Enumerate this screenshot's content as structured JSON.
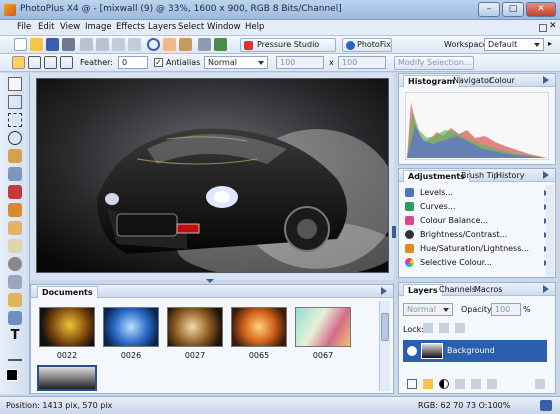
{
  "window": {
    "title": "PhotoPlus X4 @ - [mixwall (9) @ 33%, 1600 x 900, RGB 8 Bits/Channel]"
  },
  "menu": [
    "File",
    "Edit",
    "View",
    "Image",
    "Effects",
    "Layers",
    "Select",
    "Window",
    "Help"
  ],
  "toolbar": {
    "pressure_studio": "Pressure Studio",
    "photofix": "PhotoFix",
    "workspace_label": "Workspace",
    "workspace_value": "Default"
  },
  "context_bar": {
    "feather_label": "Feather:",
    "feather_value": "0",
    "antialias_label": "Antialias",
    "mode_value": "Normal",
    "width_value": "100",
    "x_label": "x",
    "height_value": "100",
    "modify_selection": "Modify Selection..."
  },
  "histogram_panel": {
    "tabs": [
      "Histogram",
      "Navigator",
      "Colour"
    ]
  },
  "adjustments_panel": {
    "tabs": [
      "Adjustments",
      "Brush Tip",
      "History"
    ],
    "items": [
      {
        "label": "Levels...",
        "color": "#4a78c2"
      },
      {
        "label": "Curves...",
        "color": "#2e9c5a"
      },
      {
        "label": "Colour Balance...",
        "color": "#d84b8a"
      },
      {
        "label": "Brightness/Contrast...",
        "color": "#333333"
      },
      {
        "label": "Hue/Saturation/Lightness...",
        "color": "#e0892a"
      },
      {
        "label": "Selective Colour...",
        "color": "#8b3fc7"
      }
    ]
  },
  "layers_panel": {
    "tabs": [
      "Layers",
      "Channels",
      "Macros"
    ],
    "blend_mode": "Normal",
    "opacity_label": "Opacity:",
    "opacity_value": "100",
    "opacity_unit": "%",
    "lock_label": "Lock:",
    "layers": [
      {
        "name": "Background"
      }
    ]
  },
  "documents_panel": {
    "title": "Documents",
    "thumbnails": [
      {
        "label": "0022"
      },
      {
        "label": "0026"
      },
      {
        "label": "0027"
      },
      {
        "label": "0065"
      },
      {
        "label": "0067"
      },
      {
        "label": ""
      }
    ]
  },
  "status": {
    "position": "Position: 1413 pix, 570 pix",
    "rgb": "RGB: 62 70 73 O:100%"
  }
}
